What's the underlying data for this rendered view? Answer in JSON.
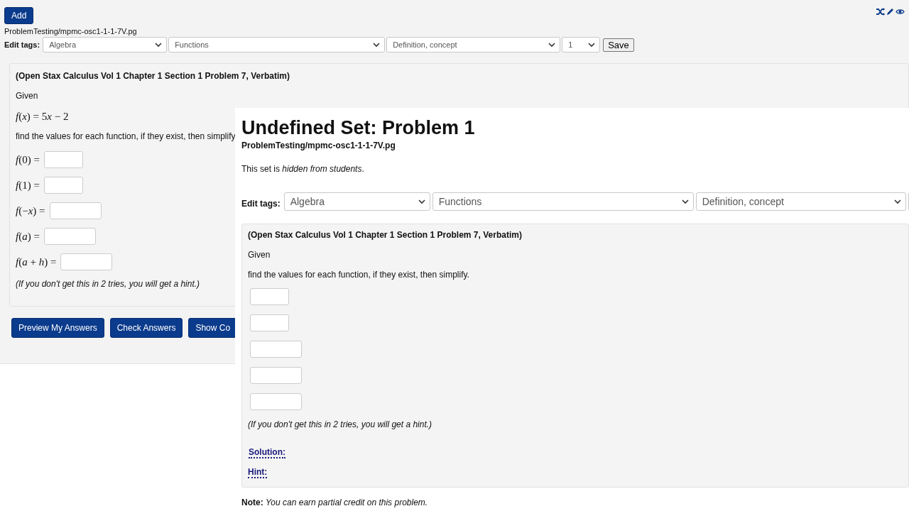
{
  "back_page": {
    "add_button": "Add",
    "file_path": "ProblemTesting/mpmc-osc1-1-1-7V.pg",
    "edit_tags": {
      "label": "Edit tags:",
      "selects": [
        {
          "value": "Algebra",
          "kind": "short"
        },
        {
          "value": "Functions",
          "kind": "long"
        },
        {
          "value": "Definition, concept",
          "kind": "medium"
        },
        {
          "value": "1",
          "kind": "tiny"
        }
      ],
      "save_button": "Save"
    },
    "problem": {
      "source": "(Open Stax Calculus Vol 1 Chapter 1 Section 1 Problem 7, Verbatim)",
      "given": "Given",
      "formula": [
        "*f*(*x*) = 5",
        "*x* − 2"
      ],
      "instruction": "find the values for each function, if they exist, then simplify.",
      "answers": [
        {
          "label": "*f*(0) =",
          "kind": "short"
        },
        {
          "label": "*f*(1) =",
          "kind": "short"
        },
        {
          "label": "*f*(−*x*) =",
          "kind": "long"
        },
        {
          "label": "*f*(*a*) =",
          "kind": "long"
        },
        {
          "label": "*f*(*a* + *h*) =",
          "kind": "long"
        }
      ],
      "hint_note": "(If you don't get this in 2 tries, you will get a hint.)"
    },
    "buttons": [
      "Preview My Answers",
      "Check Answers",
      "Show Co"
    ]
  },
  "front_page": {
    "title": "Undefined Set: Problem 1",
    "file_path": "ProblemTesting/mpmc-osc1-1-1-7V.pg",
    "visibility_note": "This set is *hidden from students*.",
    "edit_tags": {
      "label": "Edit tags:",
      "selects": [
        {
          "value": "Algebra",
          "kind": "short"
        },
        {
          "value": "Functions",
          "kind": "long"
        },
        {
          "value": "Definition, concept",
          "kind": "medium"
        }
      ]
    },
    "problem": {
      "source": "(Open Stax Calculus Vol 1 Chapter 1 Section 1 Problem 7, Verbatim)",
      "given": "Given",
      "instruction": "find the values for each function, if they exist, then simplify.",
      "answers": [
        {
          "kind": "short"
        },
        {
          "kind": "short"
        },
        {
          "kind": "long"
        },
        {
          "kind": "long"
        },
        {
          "kind": "long"
        }
      ],
      "hint_note": "(If you don't get this in 2 tries, you will get a hint.)",
      "links": [
        "Solution:",
        "Hint:"
      ]
    },
    "note": "**Note:** *You can earn partial credit on this problem.*"
  }
}
